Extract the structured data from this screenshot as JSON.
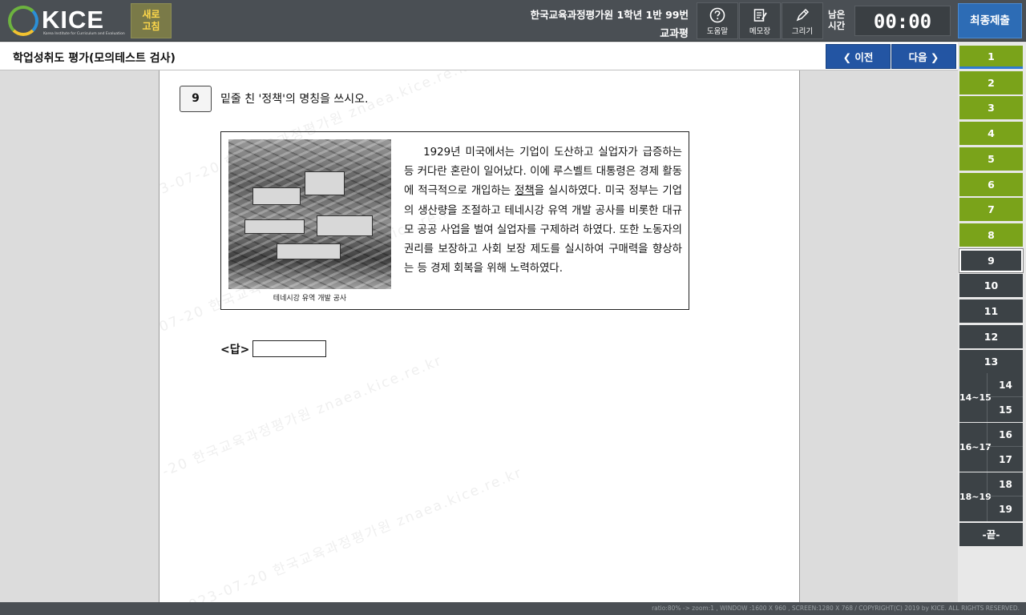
{
  "header": {
    "logo_text": "KICE",
    "logo_sub": "Korea Institute for Curriculum and Evaluation",
    "refresh_label_1": "새로",
    "refresh_label_2": "고침",
    "school_info": "한국교육과정평가원 1학년 1반 99번",
    "subject": "교과평",
    "tools": {
      "help": "도움말",
      "memo": "메모장",
      "draw": "그리기"
    },
    "remain_label_1": "남은",
    "remain_label_2": "시간",
    "timer": "00:00",
    "submit_label": "최종제출"
  },
  "titlebar": {
    "title": "학업성취도 평가(모의테스트 검사)",
    "prev_label": "❮ 이전",
    "next_label": "다음 ❯"
  },
  "question": {
    "number": "9",
    "text": "밑줄 친 '정책'의 명칭을 쓰시오.",
    "caption": "테네시강 유역 개발 공사",
    "passage_pre": "1929년 미국에서는 기업이 도산하고 실업자가 급증하는 등 커다란 혼란이 일어났다. 이에 루스벨트 대통령은 경제 활동에 적극적으로 개입하는 ",
    "passage_underline": "정책",
    "passage_post": "을 실시하였다. 미국 정부는 기업의 생산량을 조절하고 테네시강 유역 개발 공사를 비롯한 대규모 공공 사업을 벌여 실업자를 구제하려 하였다. 또한 노동자의 권리를 보장하고 사회 보장 제도를 실시하여 구매력을 향상하는 등 경제 회복을 위해 노력하였다.",
    "answer_label": "<답>"
  },
  "watermark": "2023-07-20 한국교육과정평가원 znaea.kice.re.kr",
  "nav": {
    "items": [
      {
        "label": "1",
        "state": "first"
      },
      {
        "label": "2",
        "state": "done"
      },
      {
        "label": "3",
        "state": "done"
      },
      {
        "label": "4",
        "state": "done"
      },
      {
        "label": "5",
        "state": "done"
      },
      {
        "label": "6",
        "state": "done"
      },
      {
        "label": "7",
        "state": "done"
      },
      {
        "label": "8",
        "state": "done"
      },
      {
        "label": "9",
        "state": "cur"
      },
      {
        "label": "10",
        "state": "todo"
      },
      {
        "label": "11",
        "state": "todo"
      },
      {
        "label": "12",
        "state": "todo"
      },
      {
        "label": "13",
        "state": "todo"
      }
    ],
    "groups": [
      {
        "label": "14~15",
        "a": "14",
        "b": "15"
      },
      {
        "label": "16~17",
        "a": "16",
        "b": "17"
      },
      {
        "label": "18~19",
        "a": "18",
        "b": "19"
      }
    ],
    "end_label": "-끝-"
  },
  "footer": {
    "text": "ratio:80% -> zoom:1 , WINDOW :1600 X 960 , SCREEN:1280 X 768 / COPYRIGHT(C) 2019 by KICE. ALL RIGHTS RESERVED."
  }
}
